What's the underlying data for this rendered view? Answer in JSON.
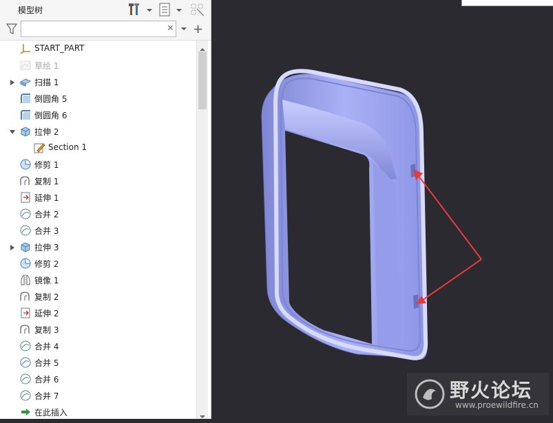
{
  "panel": {
    "title": "模型树",
    "search": {
      "value": "",
      "placeholder": ""
    }
  },
  "tree": [
    {
      "label": "START_PART",
      "icon": "csys-icon",
      "expandable": false,
      "disabled": false,
      "indent": 0
    },
    {
      "label": "草绘 1",
      "icon": "sketch-icon",
      "expandable": false,
      "disabled": true,
      "indent": 0
    },
    {
      "label": "扫描 1",
      "icon": "sweep-icon",
      "expandable": true,
      "disabled": false,
      "indent": 0
    },
    {
      "label": "倒圆角 5",
      "icon": "round-icon",
      "expandable": false,
      "disabled": false,
      "indent": 0
    },
    {
      "label": "倒圆角 6",
      "icon": "round-icon",
      "expandable": false,
      "disabled": false,
      "indent": 0
    },
    {
      "label": "拉伸 2",
      "icon": "extrude-icon",
      "expandable": true,
      "expanded": true,
      "disabled": false,
      "indent": 0
    },
    {
      "label": "Section 1",
      "icon": "section-sketch-icon",
      "expandable": false,
      "disabled": false,
      "indent": 1
    },
    {
      "label": "修剪 1",
      "icon": "trim-icon",
      "expandable": false,
      "disabled": false,
      "indent": 0
    },
    {
      "label": "复制 1",
      "icon": "copy-icon",
      "expandable": false,
      "disabled": false,
      "indent": 0
    },
    {
      "label": "延伸 1",
      "icon": "extend-icon",
      "expandable": false,
      "disabled": false,
      "indent": 0
    },
    {
      "label": "合并 2",
      "icon": "merge-icon",
      "expandable": false,
      "disabled": false,
      "indent": 0
    },
    {
      "label": "合并 3",
      "icon": "merge-icon",
      "expandable": false,
      "disabled": false,
      "indent": 0
    },
    {
      "label": "拉伸 3",
      "icon": "extrude-icon",
      "expandable": true,
      "disabled": false,
      "indent": 0
    },
    {
      "label": "修剪 2",
      "icon": "trim-icon",
      "expandable": false,
      "disabled": false,
      "indent": 0
    },
    {
      "label": "镜像 1",
      "icon": "mirror-icon",
      "expandable": false,
      "disabled": false,
      "indent": 0
    },
    {
      "label": "复制 2",
      "icon": "copy-icon",
      "expandable": false,
      "disabled": false,
      "indent": 0
    },
    {
      "label": "延伸 2",
      "icon": "extend-icon",
      "expandable": false,
      "disabled": false,
      "indent": 0
    },
    {
      "label": "复制 3",
      "icon": "copy-icon",
      "expandable": false,
      "disabled": false,
      "indent": 0
    },
    {
      "label": "合并 4",
      "icon": "merge-icon",
      "expandable": false,
      "disabled": false,
      "indent": 0
    },
    {
      "label": "合并 5",
      "icon": "merge-icon",
      "expandable": false,
      "disabled": false,
      "indent": 0
    },
    {
      "label": "合并 6",
      "icon": "merge-icon",
      "expandable": false,
      "disabled": false,
      "indent": 0
    },
    {
      "label": "合并 7",
      "icon": "merge-icon",
      "expandable": false,
      "disabled": false,
      "indent": 0
    },
    {
      "label": "在此插入",
      "icon": "insert-here-icon",
      "expandable": false,
      "disabled": false,
      "indent": 0
    }
  ],
  "viewport": {
    "background": "#2b2a30",
    "model_color": "#9ea6f0",
    "arrow_color": "#e83a3a"
  },
  "watermark": {
    "text": "野火论坛",
    "url": "www.proewildfire.cn"
  }
}
